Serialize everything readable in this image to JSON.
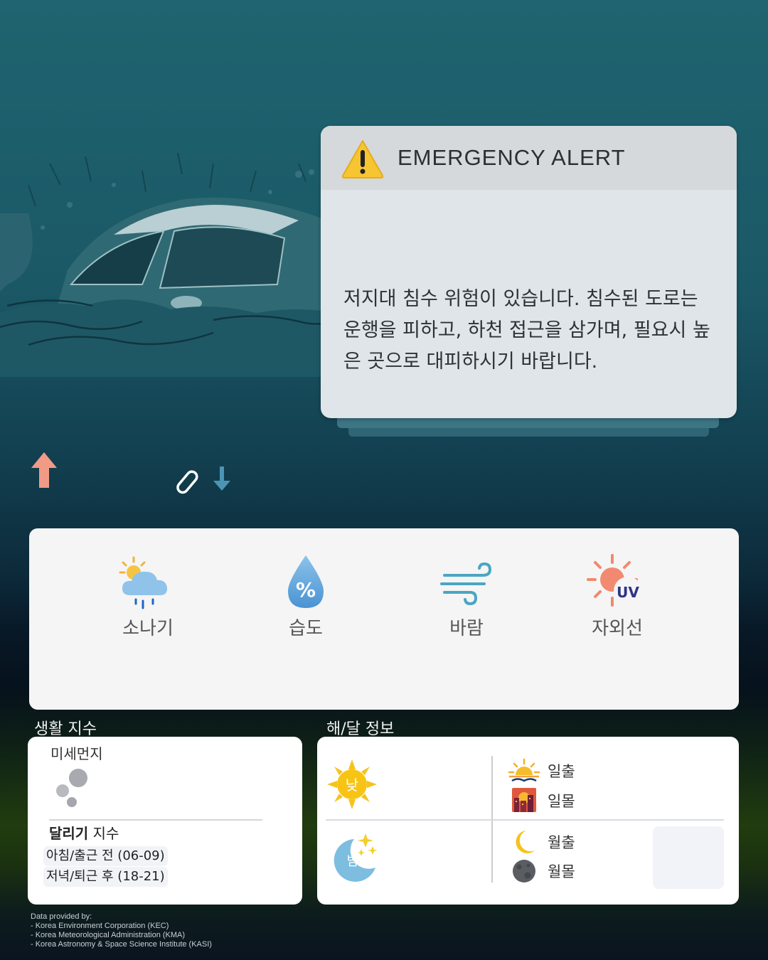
{
  "alert": {
    "title": "EMERGENCY ALERT",
    "body": "저지대 침수 위험이 있습니다. 침수된 도로는 운행을 피하고, 하천 접근을 삼가며, 필요시 높은 곳으로 대피하시기 바랍니다."
  },
  "weather": {
    "items": [
      {
        "label": "소나기",
        "icon": "sun-rain-cloud-icon"
      },
      {
        "label": "습도",
        "icon": "humidity-drop-icon"
      },
      {
        "label": "바람",
        "icon": "wind-icon"
      },
      {
        "label": "자외선",
        "icon": "uv-sun-icon"
      }
    ]
  },
  "life": {
    "section_title": "생활 지수",
    "dust_label": "미세먼지",
    "running_title_bold": "달리기",
    "running_title_rest": " 지수",
    "rows": [
      "아침/출근 전 (06-09)",
      "저녁/퇴근 후 (18-21)"
    ]
  },
  "sunmoon": {
    "section_title": "해/달 정보",
    "day_label": "낮",
    "night_label": "밤",
    "sunrise": "일출",
    "sunset": "일몰",
    "moonrise": "월출",
    "moonset": "월몰"
  },
  "credits": "Data provided by:\n- Korea Environment Corporation (KEC)\n- Korea Meteorological Administration (KMA)\n- Korea Astronomy & Space Science Institute (KASI)",
  "colors": {
    "alert_card": "#dfe5e8",
    "warning_yellow": "#f6c531",
    "up_arrow": "#f19a86",
    "down_arrow": "#4b95b4"
  }
}
